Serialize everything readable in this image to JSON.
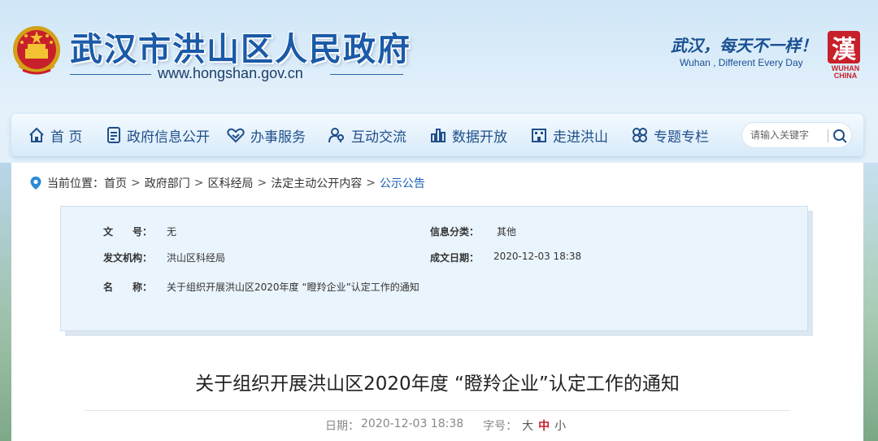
{
  "header": {
    "site_title": "武汉市洪山区人民政府",
    "site_url": "www.hongshan.gov.cn",
    "slogan": "武汉，每天不一样！",
    "slogan_en": "Wuhan , Different Every Day",
    "logo_char": "漢",
    "logo_text": "WUHAN CHINA"
  },
  "nav": {
    "items": [
      {
        "label": "首 页",
        "icon": "home-icon"
      },
      {
        "label": "政府信息公开",
        "icon": "document-icon"
      },
      {
        "label": "办事服务",
        "icon": "handshake-icon"
      },
      {
        "label": "互动交流",
        "icon": "people-icon"
      },
      {
        "label": "数据开放",
        "icon": "bar-chart-icon"
      },
      {
        "label": "走进洪山",
        "icon": "building-icon"
      },
      {
        "label": "专题专栏",
        "icon": "clover-icon"
      }
    ],
    "search_placeholder": "请输入关键字"
  },
  "breadcrumb": {
    "prefix": "当前位置：",
    "items": [
      "首页",
      "政府部门",
      "区科经局",
      "法定主动公开内容",
      "公示公告"
    ],
    "separator": ">"
  },
  "info": {
    "doc_no_label": "文　　号：",
    "doc_no_value": "无",
    "category_label": "信息分类：",
    "category_value": "其他",
    "issuer_label": "发文机构：",
    "issuer_value": "洪山区科经局",
    "date_label": "成文日期：",
    "date_value": "2020-12-03 18:38",
    "name_label": "名　　称：",
    "name_value": "关于组织开展洪山区2020年度 “瞪羚企业”认定工作的通知"
  },
  "article": {
    "title": "关于组织开展洪山区2020年度 “瞪羚企业”认定工作的通知",
    "date_label": "日期：",
    "date_value": "2020-12-03 18:38",
    "font_size_label": "字号：",
    "font_sizes": [
      "大",
      "中",
      "小"
    ],
    "active_font_size": "中"
  },
  "colors": {
    "brand_blue": "#1a5aa8",
    "accent_red": "#c8202a",
    "link_blue": "#1a5fb4"
  }
}
